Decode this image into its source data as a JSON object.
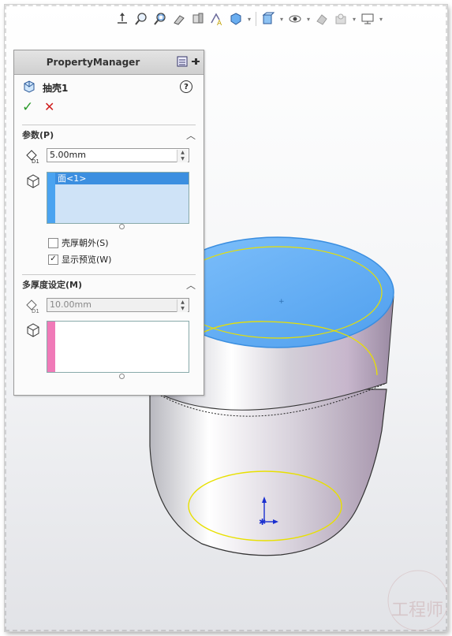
{
  "property_manager": {
    "title": "PropertyManager",
    "feature_name": "抽壳1",
    "help": "?",
    "ok": "✓",
    "cancel": "✕"
  },
  "parameters": {
    "header": "参数(P)",
    "thickness": "5.00mm",
    "faces": [
      "面<1>"
    ],
    "shell_outward_label": "壳厚朝外(S)",
    "shell_outward_checked": false,
    "show_preview_label": "显示预览(W)",
    "show_preview_checked": true
  },
  "multi_thickness": {
    "header": "多厚度设定(M)",
    "thickness": "10.00mm",
    "faces": []
  },
  "colors": {
    "face_selection": "#4aa3f0",
    "multi_selection": "#f07ab8",
    "ok": "#2a9a2a",
    "cancel": "#d02020"
  },
  "hud_icons": [
    "view-orientation-icon",
    "zoom-to-fit-icon",
    "zoom-area-icon",
    "previous-view-icon",
    "section-view-icon",
    "dynamic-annotation-icon",
    "view-settings-icon",
    "display-style-icon",
    "hide-show-icon",
    "edit-appearance-icon",
    "apply-scene-icon",
    "display-icon"
  ]
}
